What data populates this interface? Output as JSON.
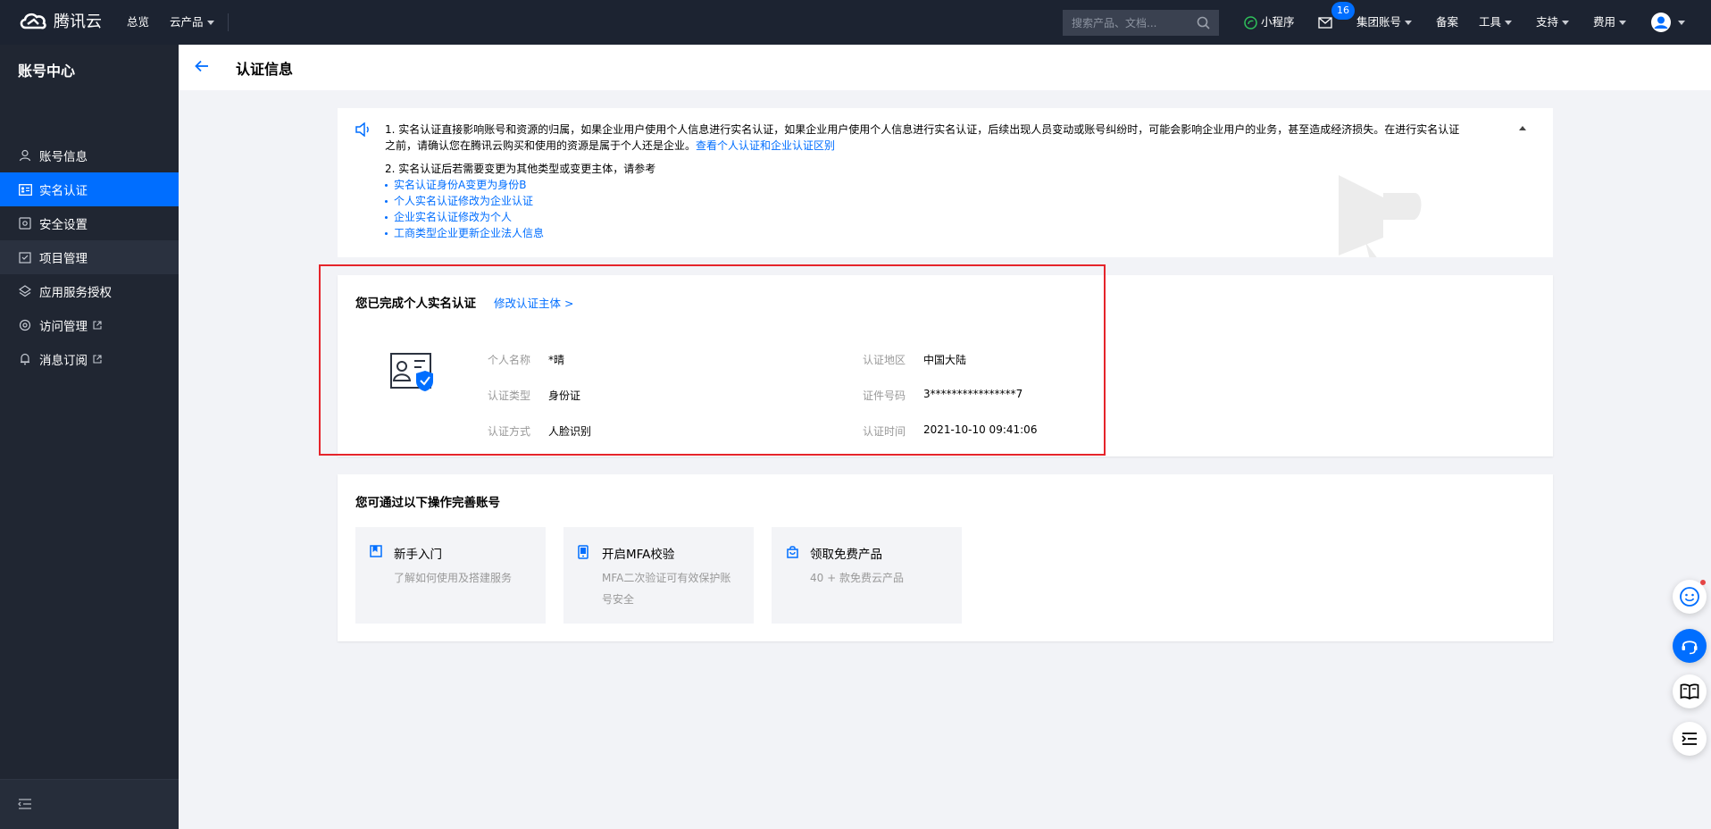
{
  "topbar": {
    "brand": "腾讯云",
    "nav": {
      "overview": "总览",
      "products": "云产品"
    },
    "search": {
      "placeholder": "搜索产品、文档..."
    },
    "miniprogram": "小程序",
    "message_count": "16",
    "group_account": "集团账号",
    "filing": "备案",
    "tools": "工具",
    "support": "支持",
    "billing": "费用"
  },
  "sidebar": {
    "title": "账号中心",
    "items": [
      {
        "label": "账号信息",
        "icon": "user-icon"
      },
      {
        "label": "实名认证",
        "icon": "id-card-icon",
        "active": true
      },
      {
        "label": "安全设置",
        "icon": "shield-icon"
      },
      {
        "label": "项目管理",
        "icon": "project-icon"
      },
      {
        "label": "应用服务授权",
        "icon": "layers-icon"
      },
      {
        "label": "访问管理",
        "icon": "access-icon",
        "external": true
      },
      {
        "label": "消息订阅",
        "icon": "bell-icon",
        "external": true
      }
    ]
  },
  "page": {
    "title": "认证信息"
  },
  "notice": {
    "line1": "1. 实名认证直接影响账号和资源的归属，如果企业用户使用个人信息进行实名认证，如果企业用户使用个人信息进行实名认证，后续出现人员变动或账号纠纷时，可能会影响企业用户的业务，甚至造成经济损失。在进行实名认证之前，请确认您在腾讯云购买和使用的资源是属于个人还是企业。",
    "line1_link": "查看个人认证和企业认证区别",
    "line2": "2. 实名认证后若需要变更为其他类型或变更主体，请参考",
    "links": [
      "实名认证身份A变更为身份B",
      "个人实名认证修改为企业认证",
      "企业实名认证修改为个人",
      "工商类型企业更新企业法人信息"
    ]
  },
  "verify_card": {
    "title": "您已完成个人实名认证",
    "edit_link": "修改认证主体 >",
    "fields": {
      "name_label": "个人名称",
      "name_value": "*晴",
      "type_label": "认证类型",
      "type_value": "身份证",
      "method_label": "认证方式",
      "method_value": "人脸识别",
      "region_label": "认证地区",
      "region_value": "中国大陆",
      "id_label": "证件号码",
      "id_value": "3****************7",
      "time_label": "认证时间",
      "time_value": "2021-10-10 09:41:06"
    }
  },
  "actions_card": {
    "title": "您可通过以下操作完善账号",
    "tiles": [
      {
        "title": "新手入门",
        "desc": "了解如何使用及搭建服务",
        "icon": "bookmark-icon"
      },
      {
        "title": "开启MFA校验",
        "desc": "MFA二次验证可有效保护账号安全",
        "icon": "phone-icon"
      },
      {
        "title": "领取免费产品",
        "desc": "40 + 款免费云产品",
        "icon": "bag-icon"
      }
    ]
  },
  "colors": {
    "brand_blue": "#006eff",
    "topbar": "#1c2331",
    "sidebar": "#202632",
    "highlight_red": "#e5242b"
  }
}
